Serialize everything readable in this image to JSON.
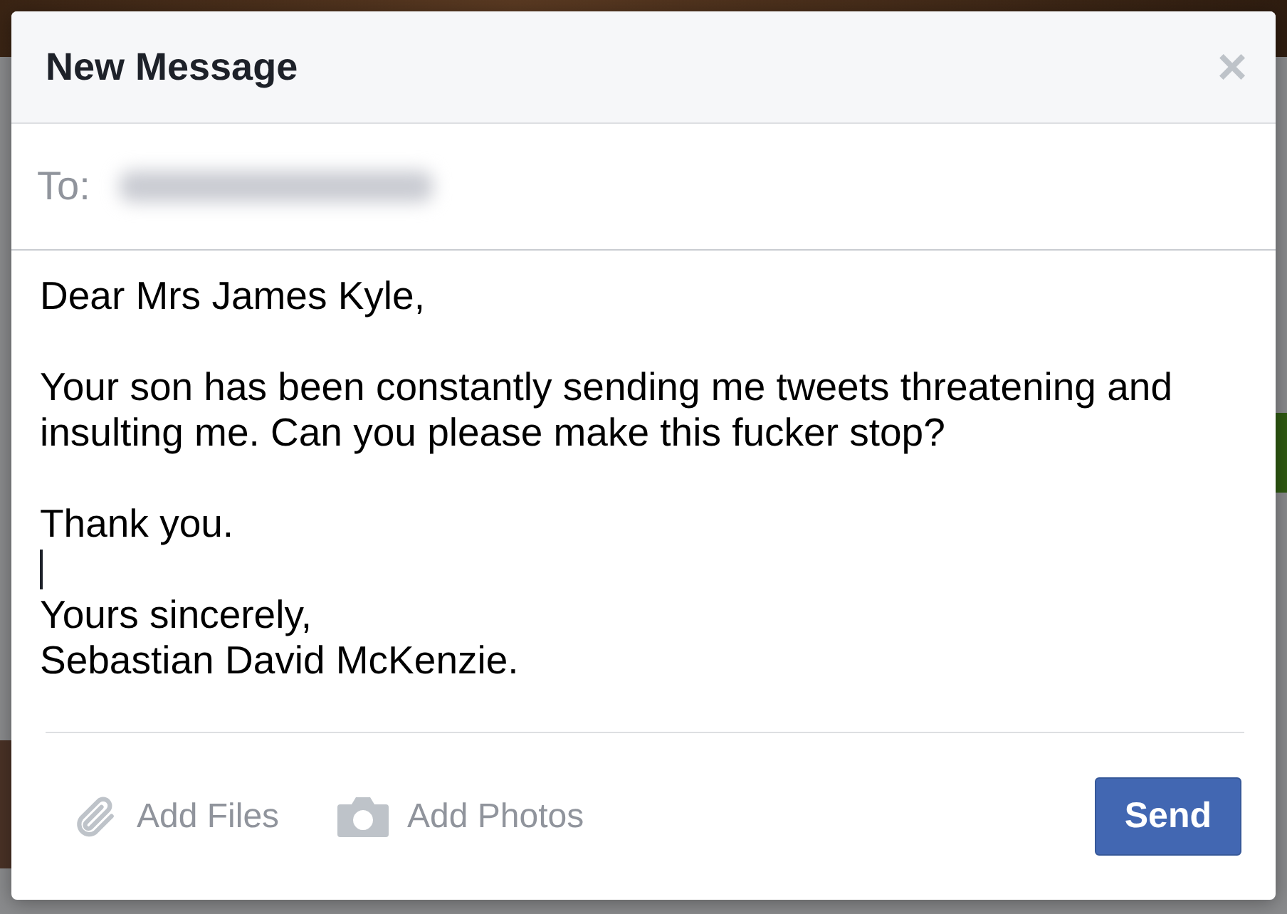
{
  "dialog": {
    "title": "New Message",
    "close": "×"
  },
  "recipient": {
    "label": "To:"
  },
  "message": {
    "lines": [
      {
        "kind": "text",
        "text": "Dear Mrs James Kyle,"
      },
      {
        "kind": "blank"
      },
      {
        "kind": "text",
        "text": "Your son has been constantly sending me tweets threatening and insulting me. Can you please make this fucker stop?"
      },
      {
        "kind": "blank"
      },
      {
        "kind": "text",
        "text": "Thank you."
      },
      {
        "kind": "caret"
      },
      {
        "kind": "text",
        "text": "Yours sincerely,"
      },
      {
        "kind": "text",
        "text": "Sebastian David McKenzie."
      }
    ]
  },
  "footer": {
    "actions": [
      {
        "kind": "files",
        "label": "Add Files"
      },
      {
        "kind": "photos",
        "label": "Add Photos"
      }
    ],
    "send": "Send"
  }
}
